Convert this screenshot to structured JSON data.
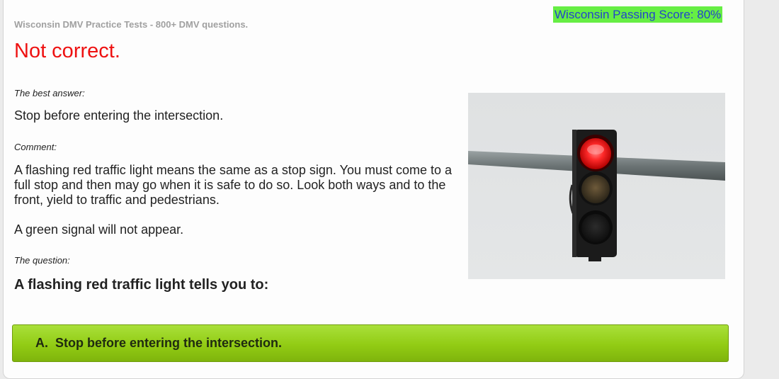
{
  "header": {
    "site_title": "Wisconsin DMV Practice Tests - 800+ DMV questions.",
    "passing_score": "Wisconsin Passing Score: 80%"
  },
  "result": {
    "heading": "Not correct."
  },
  "best_answer": {
    "label": "The best answer:",
    "text": "Stop before entering the intersection."
  },
  "comment": {
    "label": "Comment:",
    "text": "A flashing red traffic light means the same as a stop sign. You must come to a full stop and then may go when it is safe to do so. Look both ways and to the front, yield to traffic and pedestrians.",
    "extra": "A green signal will not appear."
  },
  "question": {
    "label": "The question:",
    "text": "A flashing red traffic light tells you to:"
  },
  "options": [
    {
      "letter": "A.",
      "text": "Stop before entering the intersection."
    }
  ],
  "colors": {
    "error_heading": "#ee1111",
    "passing_bg": "#66ee44",
    "passing_text": "#2244cc",
    "option_green": "#92cc14"
  },
  "image": {
    "icon": "traffic-light-red-icon"
  }
}
